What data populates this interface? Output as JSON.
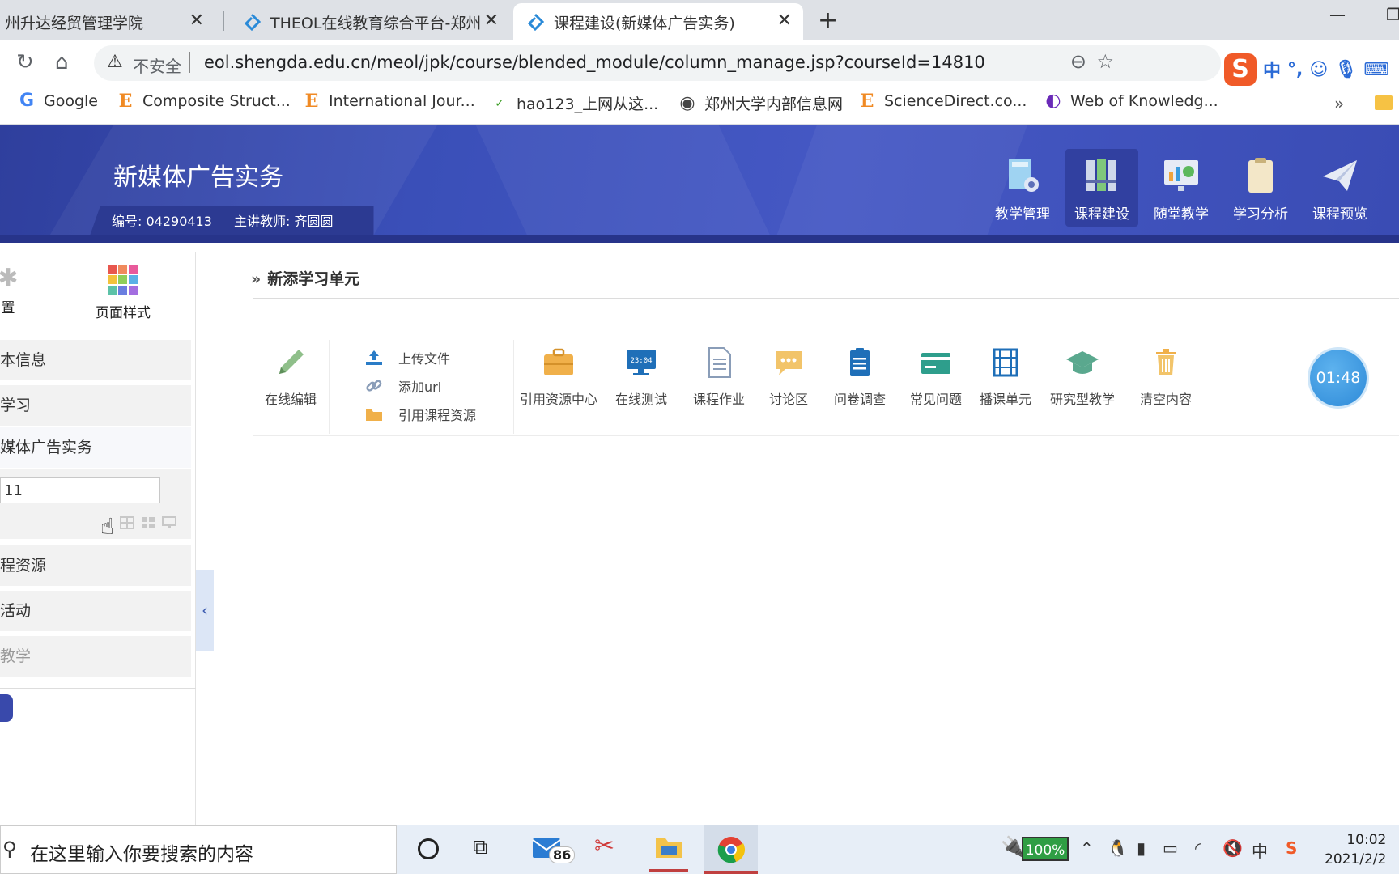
{
  "browser": {
    "tabs": [
      {
        "title": "州升达经贸管理学院",
        "active": false
      },
      {
        "title": "THEOL在线教育综合平台-郑州升",
        "active": false
      },
      {
        "title": "课程建设(新媒体广告实务)",
        "active": true
      }
    ],
    "security_label": "不安全",
    "url": "eol.shengda.edu.cn/meol/jpk/course/blended_module/column_manage.jsp?courseId=14810",
    "ime": {
      "lang": "中",
      "punct": "°,"
    },
    "bookmarks": [
      {
        "label": "Google",
        "icon": "google-icon"
      },
      {
        "label": "Composite Struct...",
        "icon": "elsevier-icon"
      },
      {
        "label": "International Jour...",
        "icon": "elsevier-icon"
      },
      {
        "label": "hao123_上网从这...",
        "icon": "hao123-icon"
      },
      {
        "label": "郑州大学内部信息网",
        "icon": "globe-icon"
      },
      {
        "label": "ScienceDirect.co...",
        "icon": "elsevier-icon"
      },
      {
        "label": "Web of Knowledg...",
        "icon": "clarivate-icon"
      }
    ],
    "bookmarks_more": "»"
  },
  "header": {
    "course_title": "新媒体广告实务",
    "code_label": "编号: 04290413",
    "teacher_label": "主讲教师: 齐圆圆",
    "nav": [
      {
        "label": "教学管理",
        "active": false
      },
      {
        "label": "课程建设",
        "active": true
      },
      {
        "label": "随堂教学",
        "active": false
      },
      {
        "label": "学习分析",
        "active": false
      },
      {
        "label": "课程预览",
        "active": false
      }
    ]
  },
  "sidebar": {
    "tools": [
      {
        "label": "置"
      },
      {
        "label": "页面样式"
      }
    ],
    "items": [
      {
        "label": "本信息"
      },
      {
        "label": "学习"
      },
      {
        "label": "媒体广告实务"
      },
      {
        "label": "程资源"
      },
      {
        "label": "活动"
      },
      {
        "label": "教学"
      }
    ],
    "edit_value": "11",
    "collapse_icon": "‹"
  },
  "main": {
    "section_title": "新添学习单元",
    "edit_tool": {
      "label": "在线编辑"
    },
    "upload_links": [
      {
        "label": "上传文件"
      },
      {
        "label": "添加url"
      },
      {
        "label": "引用课程资源"
      }
    ],
    "tools": [
      {
        "label": "引用资源中心"
      },
      {
        "label": "在线测试"
      },
      {
        "label": "课程作业"
      },
      {
        "label": "讨论区"
      },
      {
        "label": "问卷调查"
      },
      {
        "label": "常见问题"
      },
      {
        "label": "播课单元"
      },
      {
        "label": "研究型教学"
      },
      {
        "label": "清空内容"
      }
    ],
    "timer": "01:48"
  },
  "taskbar": {
    "search_placeholder": "在这里输入你要搜索的内容",
    "mail_badge": "86",
    "battery": "100%",
    "ime_lang": "中",
    "time": "10:02",
    "date": "2021/2/2"
  },
  "colors": {
    "header_blue": "#3a4fb8",
    "accent_blue": "#2e8ad8",
    "tool_orange": "#f0b04a",
    "tool_teal": "#2e9e8c"
  }
}
